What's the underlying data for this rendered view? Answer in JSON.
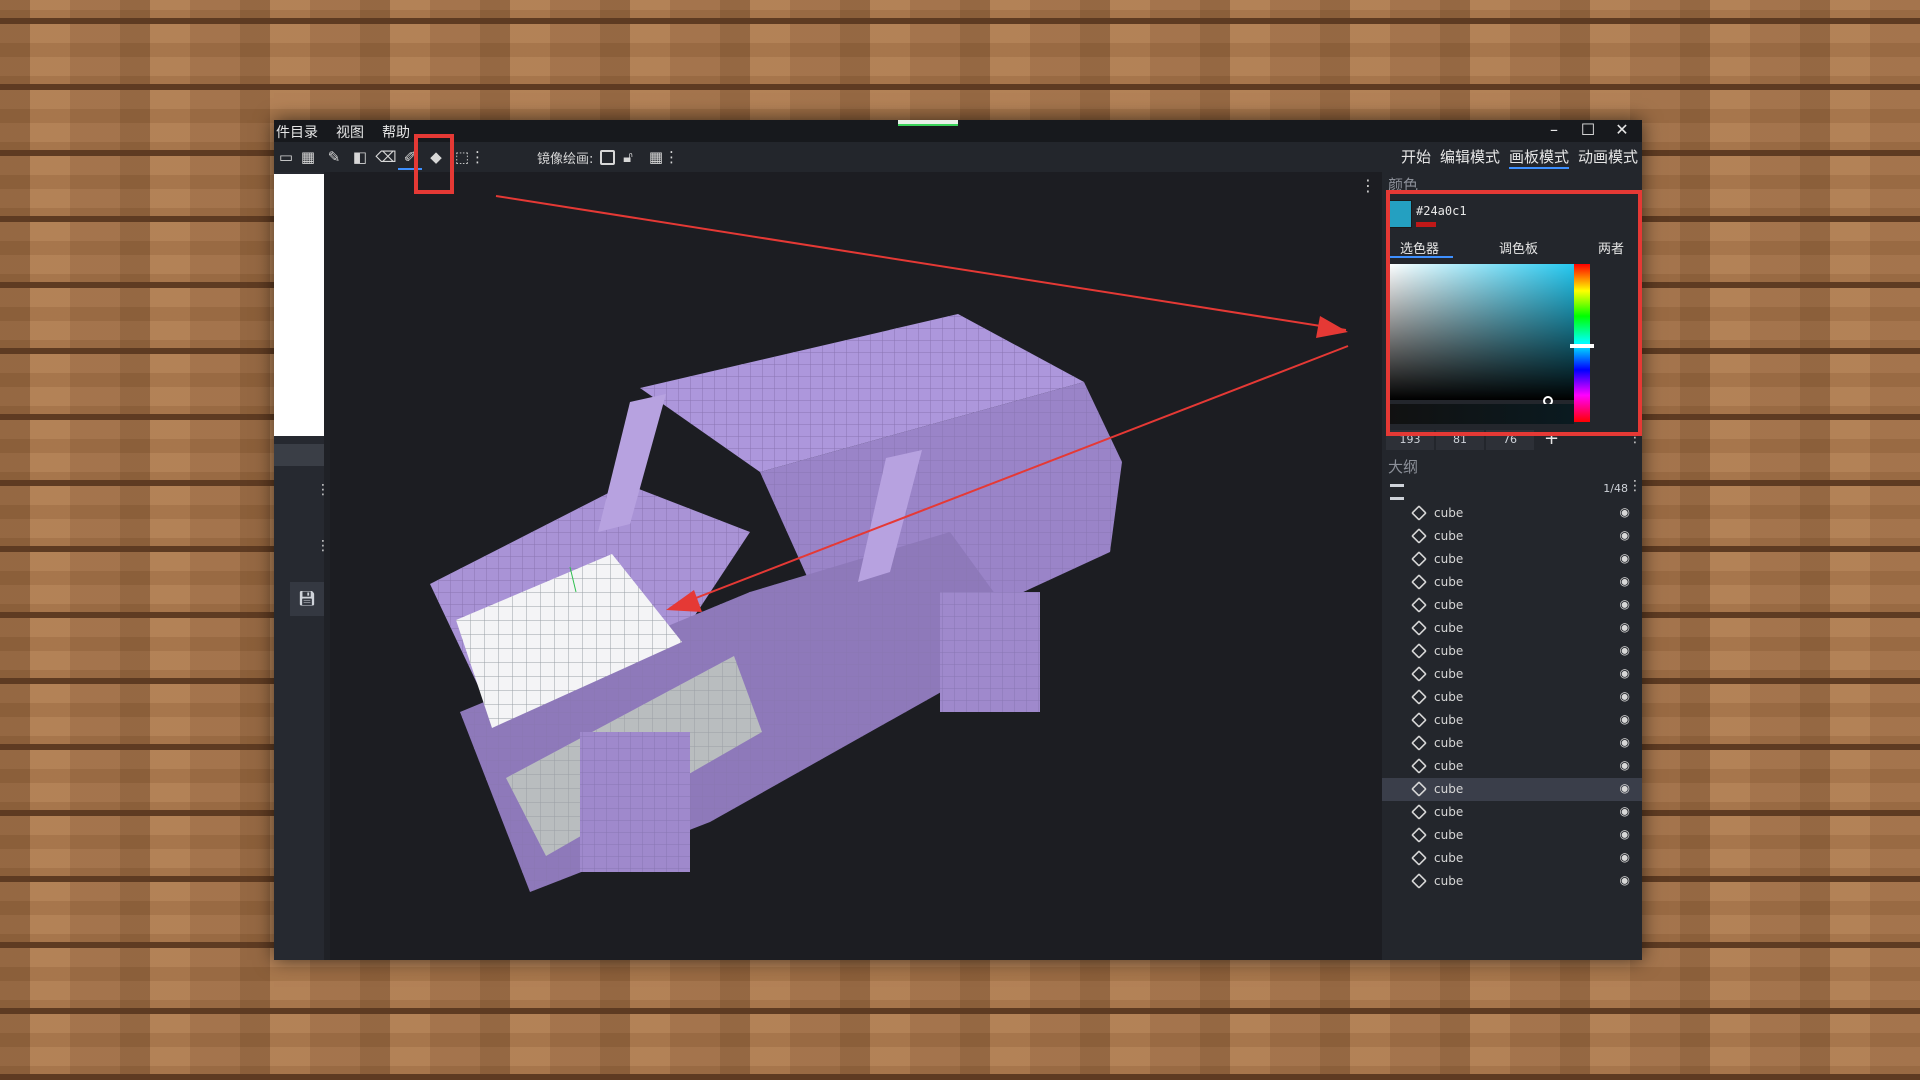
{
  "menu": [
    "件目录",
    "视图",
    "帮助"
  ],
  "window_controls": {
    "minimize": "–",
    "maximize": "☐",
    "close": "✕"
  },
  "toolbar": {
    "mirror_label": "镜像绘画:",
    "mode_tabs": [
      {
        "label": "开始",
        "active": false
      },
      {
        "label": "编辑模式",
        "active": false
      },
      {
        "label": "画板模式",
        "active": true
      },
      {
        "label": "动画模式",
        "active": false
      }
    ],
    "active_tool": "color-picker-icon"
  },
  "color_panel": {
    "title": "颜色",
    "hex": "#24a0c1",
    "swatch_color": "#24a0c1",
    "tabs": [
      {
        "label": "选色器",
        "active": true
      },
      {
        "label": "调色板",
        "active": false
      },
      {
        "label": "两者",
        "active": false
      }
    ],
    "values": [
      "193",
      "81",
      "76"
    ],
    "add_label": "+"
  },
  "outline_panel": {
    "title": "大纲",
    "count": "1/48",
    "items": [
      {
        "label": "cube",
        "selected": false
      },
      {
        "label": "cube",
        "selected": false
      },
      {
        "label": "cube",
        "selected": false
      },
      {
        "label": "cube",
        "selected": false
      },
      {
        "label": "cube",
        "selected": false
      },
      {
        "label": "cube",
        "selected": false
      },
      {
        "label": "cube",
        "selected": false
      },
      {
        "label": "cube",
        "selected": false
      },
      {
        "label": "cube",
        "selected": false
      },
      {
        "label": "cube",
        "selected": false
      },
      {
        "label": "cube",
        "selected": false
      },
      {
        "label": "cube",
        "selected": false
      },
      {
        "label": "cube",
        "selected": true
      },
      {
        "label": "cube",
        "selected": false
      },
      {
        "label": "cube",
        "selected": false
      },
      {
        "label": "cube",
        "selected": false
      },
      {
        "label": "cube",
        "selected": false
      }
    ]
  },
  "colors": {
    "accent": "#3e90ff",
    "annotation_red": "#e53935",
    "model_purple": "#a58fd1"
  }
}
